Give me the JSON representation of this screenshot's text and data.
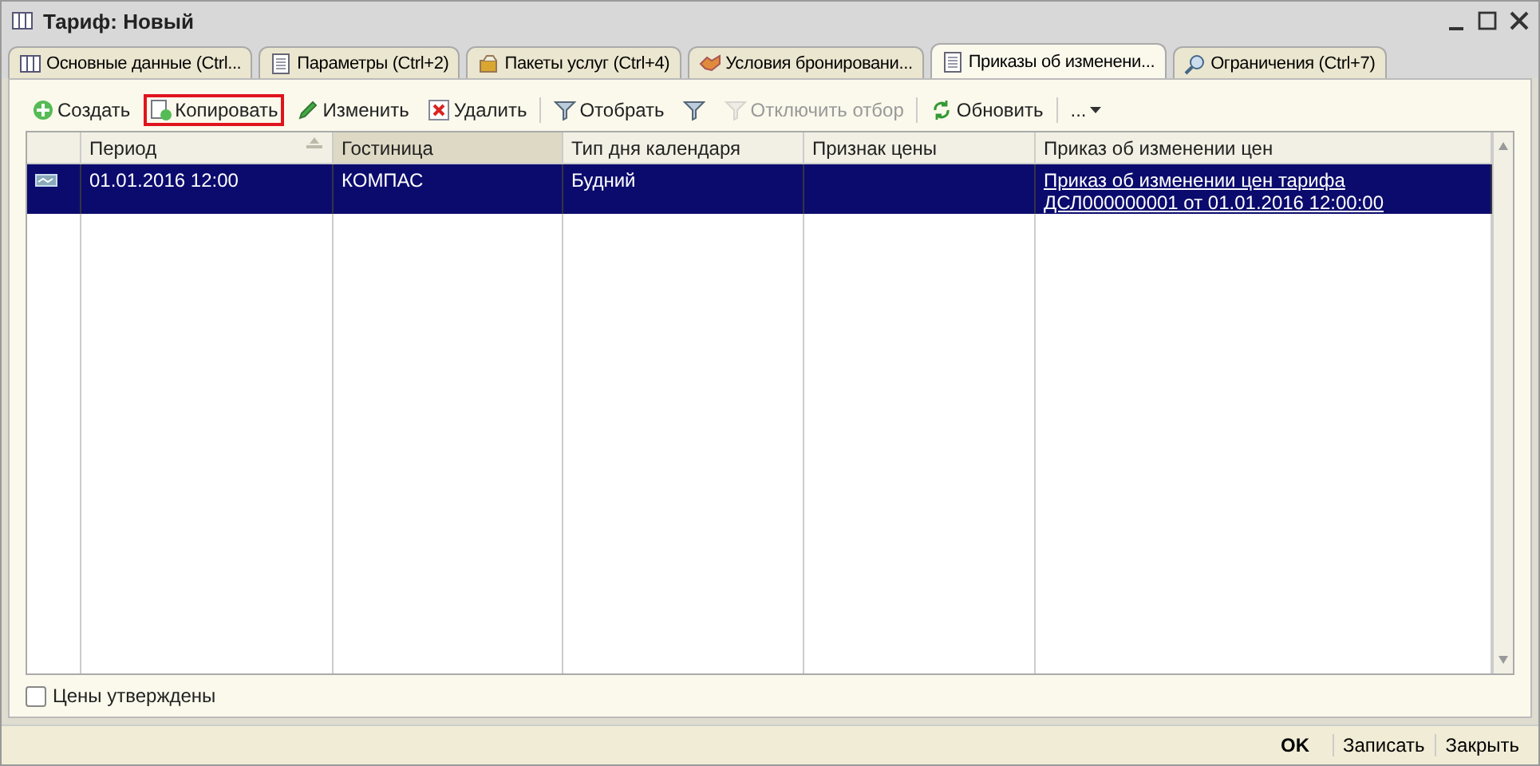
{
  "window": {
    "title": "Тариф: Новый"
  },
  "tabs": [
    {
      "label": "Основные данные (Ctrl...",
      "selected": false
    },
    {
      "label": "Параметры (Ctrl+2)",
      "selected": false
    },
    {
      "label": "Пакеты услуг (Ctrl+4)",
      "selected": false
    },
    {
      "label": "Условия бронировани...",
      "selected": false
    },
    {
      "label": "Приказы об изменени...",
      "selected": true
    },
    {
      "label": "Ограничения (Ctrl+7)",
      "selected": false
    }
  ],
  "toolbar": [
    {
      "kind": "button",
      "label": "Создать",
      "highlighted": false,
      "disabled": false
    },
    {
      "kind": "button",
      "label": "Копировать",
      "highlighted": true,
      "disabled": false
    },
    {
      "kind": "button",
      "label": "Изменить",
      "highlighted": false,
      "disabled": false
    },
    {
      "kind": "button",
      "label": "Удалить",
      "highlighted": false,
      "disabled": false
    },
    {
      "kind": "separator"
    },
    {
      "kind": "button",
      "label": "Отобрать",
      "highlighted": false,
      "disabled": false
    },
    {
      "kind": "button",
      "highlighted": false,
      "disabled": false
    },
    {
      "kind": "button",
      "label": "Отключить отбор",
      "highlighted": false,
      "disabled": true
    },
    {
      "kind": "separator"
    },
    {
      "kind": "button",
      "label": "Обновить",
      "highlighted": false,
      "disabled": false
    },
    {
      "kind": "separator"
    },
    {
      "kind": "menu",
      "label": "..."
    }
  ],
  "table": {
    "columns": [
      {
        "label": "Период",
        "sorted": true,
        "selected": false
      },
      {
        "label": "Гостиница",
        "sorted": false,
        "selected": true
      },
      {
        "label": "Тип дня календаря",
        "sorted": false,
        "selected": false
      },
      {
        "label": "Признак цены",
        "sorted": false,
        "selected": false
      },
      {
        "label": "Приказ об изменении цен",
        "sorted": false,
        "selected": false
      }
    ],
    "rows": [
      {
        "selected": true,
        "cells": [
          "01.01.2016 12:00",
          "КОМПАС",
          "Будний",
          "",
          "Приказ об изменении цен тарифа ДСЛ000000001 от 01.01.2016 12:00:00"
        ]
      }
    ]
  },
  "approved": {
    "label": "Цены утверждены",
    "checked": false
  },
  "footer": [
    {
      "label": "OK",
      "default": true
    },
    {
      "label": "Записать",
      "default": false
    },
    {
      "label": "Закрыть",
      "default": false
    }
  ]
}
